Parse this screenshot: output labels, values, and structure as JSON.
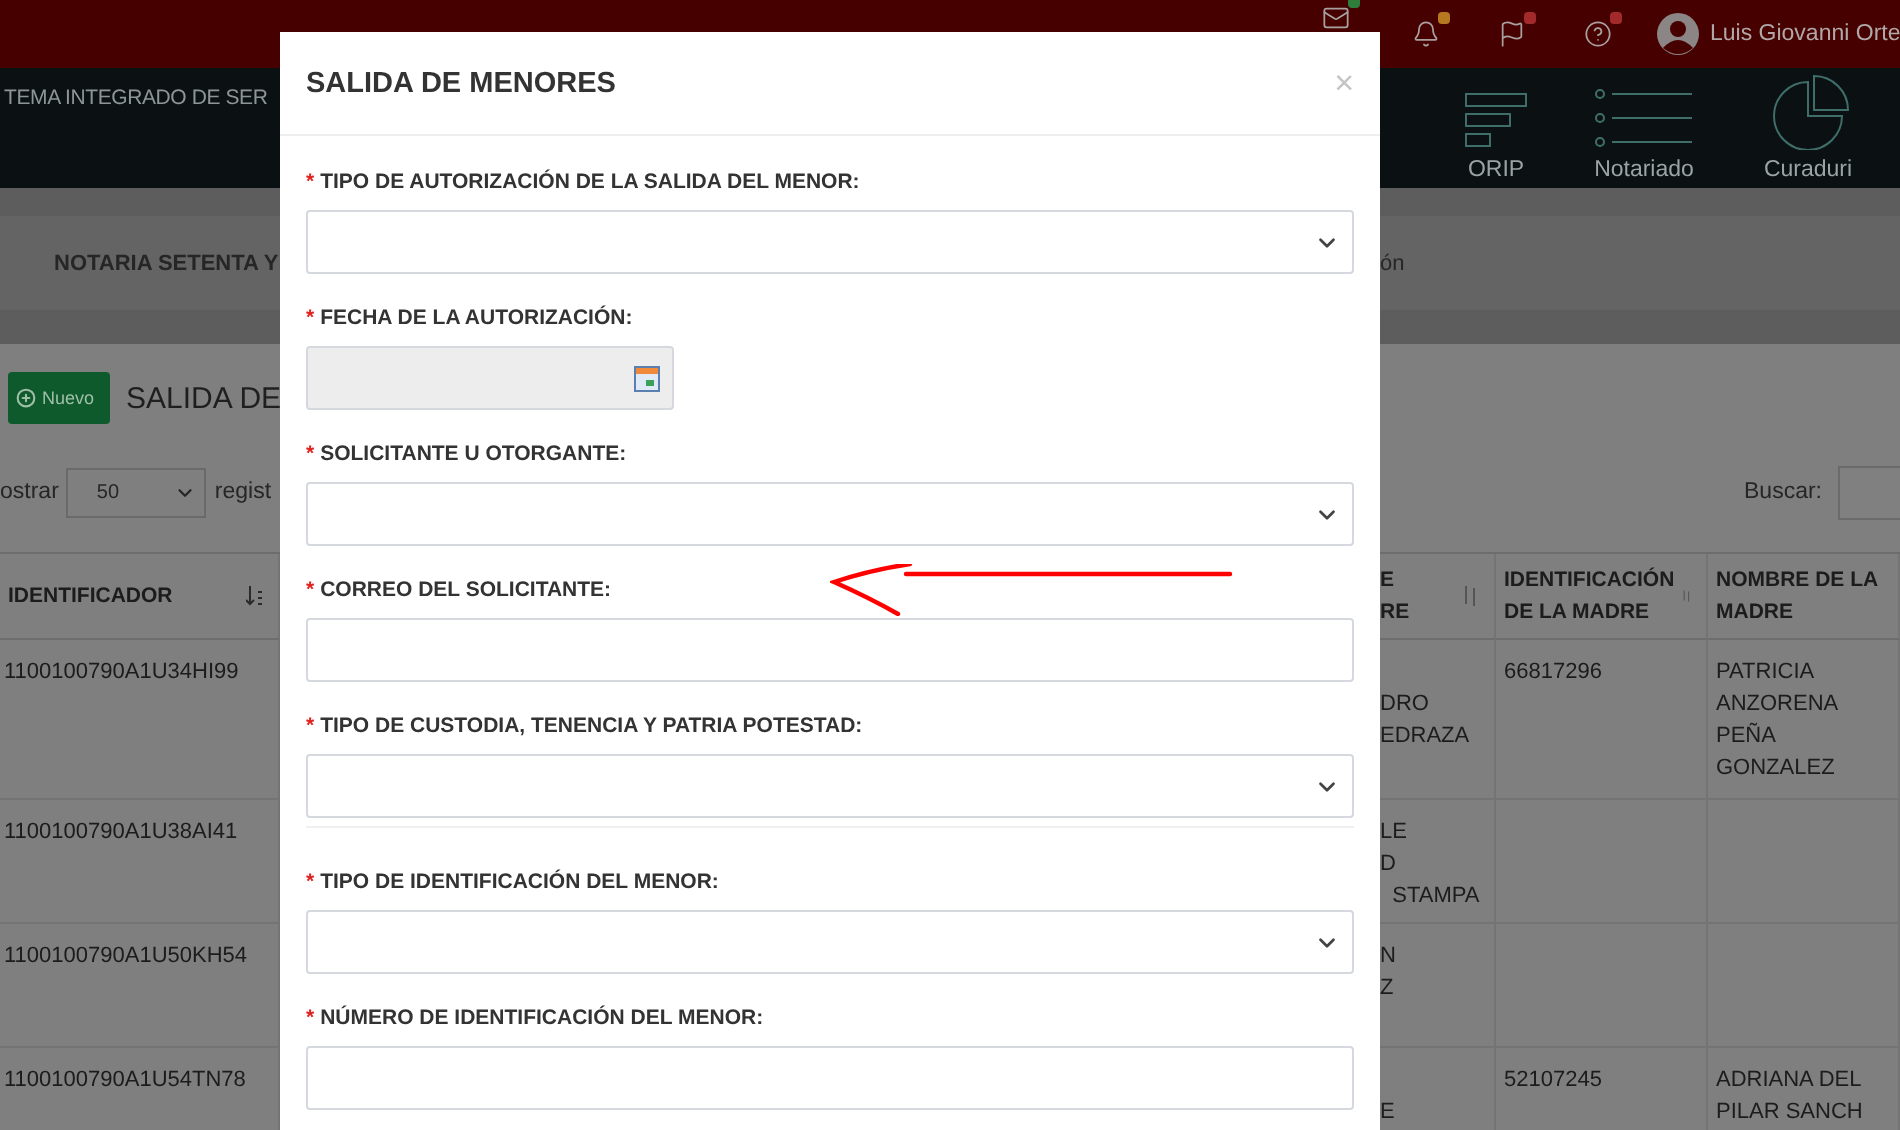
{
  "top_bar": {
    "notifications": [
      {
        "color": "#2f7d3a"
      },
      {
        "color": "#b7791f"
      },
      {
        "color": "#a32a2a"
      },
      {
        "color": "#a32a2a"
      }
    ],
    "user_name": "Luis Giovanni Orte"
  },
  "app_title": "TEMA INTEGRADO DE SER",
  "nav_items": [
    {
      "label": "ORIP"
    },
    {
      "label": "Notariado"
    },
    {
      "label": "Curaduri"
    }
  ],
  "breadcrumb": {
    "left": "NOTARIA SETENTA Y",
    "right": "ón"
  },
  "new_button": "Nuevo",
  "section_title": "SALIDA DE",
  "length_menu": {
    "prefix": "ostrar",
    "value": "50",
    "suffix": "regist"
  },
  "search_label": "Buscar:",
  "table_left": {
    "column": "IDENTIFICADOR",
    "rows": [
      "1100100790A1U34HI99",
      "1100100790A1U38AI41",
      "1100100790A1U50KH54",
      "1100100790A1U54TN78"
    ]
  },
  "table_right": {
    "columns": [
      "E\nRE",
      "IDENTIFICACIÓN DE LA MADRE",
      "NOMBRE DE LA MADRE"
    ],
    "rows": [
      [
        "\nDRO\nEDRAZA",
        "66817296",
        "PATRICIA ANZORENA PEÑA GONZALEZ"
      ],
      [
        "LE\nD\n  STAMPA",
        "",
        ""
      ],
      [
        "N\nZ",
        "",
        ""
      ],
      [
        "\nE",
        "52107245",
        "ADRIANA DEL PILAR SANCH"
      ]
    ]
  },
  "modal": {
    "title": "SALIDA DE MENORES",
    "close": "×",
    "fields": [
      {
        "kind": "select",
        "marker": "*",
        "label": "TIPO DE AUTORIZACIÓN DE LA SALIDA DEL MENOR:",
        "annotated": false
      },
      {
        "kind": "date",
        "marker": "*",
        "label": "FECHA DE LA AUTORIZACIÓN:",
        "annotated": false
      },
      {
        "kind": "select",
        "marker": "*",
        "label": "SOLICITANTE U OTORGANTE:",
        "annotated": false
      },
      {
        "kind": "text",
        "marker": "*",
        "label": "CORREO DEL SOLICITANTE:",
        "annotated": true
      },
      {
        "kind": "select",
        "marker": "*",
        "label": "TIPO DE CUSTODIA, TENENCIA Y PATRIA POTESTAD:",
        "annotated": false
      },
      {
        "kind": "divider"
      },
      {
        "kind": "select",
        "marker": "*",
        "label": "TIPO DE IDENTIFICACIÓN DEL MENOR:",
        "annotated": false
      },
      {
        "kind": "text",
        "marker": "*",
        "label": "NÚMERO DE IDENTIFICACIÓN DEL MENOR:",
        "annotated": false
      }
    ]
  }
}
